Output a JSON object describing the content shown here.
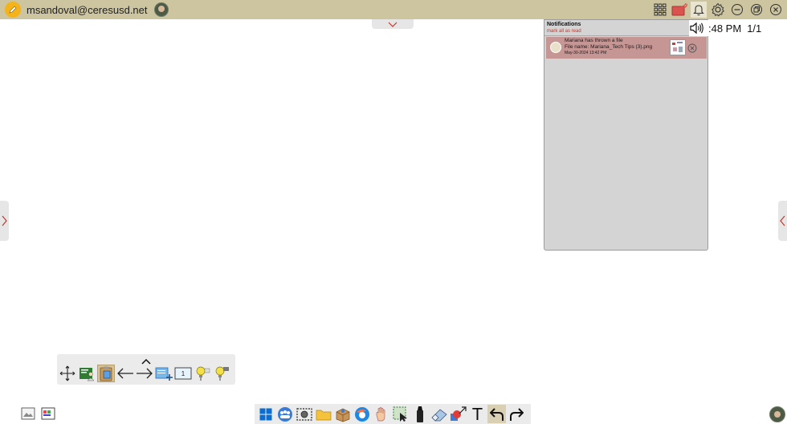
{
  "top_bar": {
    "user_email": "msandoval@ceresusd.net",
    "icons": [
      "pencil-app-icon",
      "user-avatar",
      "apps-grid-icon",
      "cast-icon",
      "bell-icon",
      "gear-icon",
      "minimize-icon",
      "restore-icon",
      "close-icon"
    ]
  },
  "notifications": {
    "title": "Notifications",
    "mark_all": "mark all as read",
    "items": [
      {
        "line1": "Mariana has thrown a file",
        "line2": "File name: Mariana_Tech Tips (3).png",
        "timestamp": "May-30-2024 13:42 PM"
      }
    ]
  },
  "status": {
    "clock": ":48 PM",
    "pages": "1/1"
  },
  "floating_toolbar": {
    "tools": [
      "move-arrows-icon",
      "whiteboard-user-icon",
      "clipboard-icon",
      "arrow-left-icon",
      "arrow-right-icon",
      "add-page-icon",
      "page-number-icon",
      "pin-bulb-icon",
      "marker-bulb-icon"
    ],
    "page_badge": "1"
  },
  "bottom_toolbar": {
    "tools": [
      "windows-start-icon",
      "group-icon",
      "screenshot-icon",
      "folder-icon",
      "box-icon",
      "browser-icon",
      "hand-icon",
      "select-icon",
      "marker-icon",
      "eraser-icon",
      "shapes-icon",
      "text-icon",
      "undo-icon",
      "redo-icon"
    ],
    "text_tool_glyph": "T"
  },
  "colors": {
    "top_bar": "#cdc4a0",
    "notification_item": "#c69695",
    "notification_panel": "#d4d4d4",
    "accent_red": "#c0392b"
  }
}
